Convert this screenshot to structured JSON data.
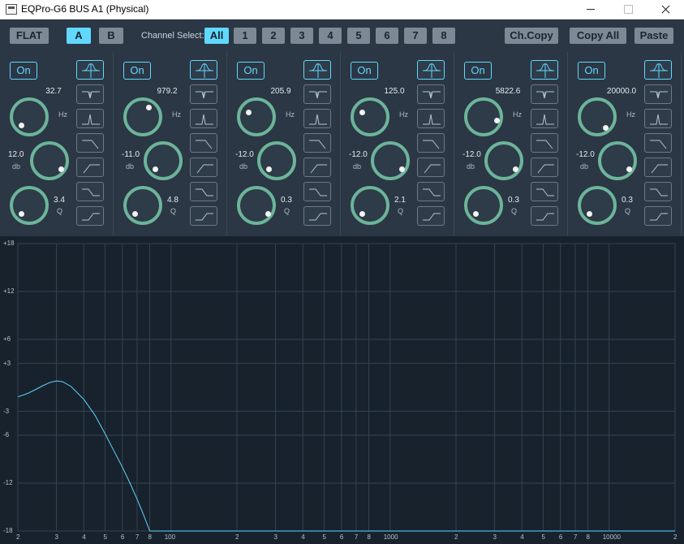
{
  "window": {
    "title": "EQPro-G6 BUS A1 (Physical)"
  },
  "toolbar": {
    "flat_label": "FLAT",
    "a_label": "A",
    "b_label": "B",
    "channel_select_label": "Channel Select:",
    "channels": [
      "All",
      "1",
      "2",
      "3",
      "4",
      "5",
      "6",
      "7",
      "8"
    ],
    "selected_channel": "All",
    "selected_bank": "A",
    "copy_label": "Ch.Copy",
    "copy_all_label": "Copy All",
    "paste_label": "Paste"
  },
  "bands": [
    {
      "on_label": "On",
      "freq": "32.7",
      "freq_unit": "Hz",
      "gain": "12.0",
      "gain_unit": "db",
      "q": "3.4",
      "q_unit": "Q",
      "active_shape": "bell"
    },
    {
      "on_label": "On",
      "freq": "979.2",
      "freq_unit": "Hz",
      "gain": "-11.0",
      "gain_unit": "db",
      "q": "4.8",
      "q_unit": "Q",
      "active_shape": "bell"
    },
    {
      "on_label": "On",
      "freq": "205.9",
      "freq_unit": "Hz",
      "gain": "-12.0",
      "gain_unit": "db",
      "q": "0.3",
      "q_unit": "Q",
      "active_shape": "bell"
    },
    {
      "on_label": "On",
      "freq": "125.0",
      "freq_unit": "Hz",
      "gain": "-12.0",
      "gain_unit": "db",
      "q": "2.1",
      "q_unit": "Q",
      "active_shape": "bell"
    },
    {
      "on_label": "On",
      "freq": "5822.6",
      "freq_unit": "Hz",
      "gain": "-12.0",
      "gain_unit": "db",
      "q": "0.3",
      "q_unit": "Q",
      "active_shape": "bell"
    },
    {
      "on_label": "On",
      "freq": "20000.0",
      "freq_unit": "Hz",
      "gain": "-12.0",
      "gain_unit": "db",
      "q": "0.3",
      "q_unit": "Q",
      "active_shape": "bell"
    }
  ],
  "filter_shapes": [
    "bell",
    "notch",
    "bandpass",
    "lowpass",
    "highpass",
    "lowshelf",
    "highshelf"
  ],
  "graph": {
    "y_labels": [
      "+18",
      "+12",
      "+6",
      "+3",
      "-3",
      "-6",
      "-12",
      "-18"
    ],
    "y_values": [
      18,
      12,
      6,
      3,
      -3,
      -6,
      -12,
      -18
    ],
    "x_labels": [
      {
        "t": "2",
        "f": 20
      },
      {
        "t": "3",
        "f": 30
      },
      {
        "t": "4",
        "f": 40
      },
      {
        "t": "5",
        "f": 50
      },
      {
        "t": "6",
        "f": 60
      },
      {
        "t": "7",
        "f": 70
      },
      {
        "t": "8",
        "f": 80
      },
      {
        "t": "100",
        "f": 100
      },
      {
        "t": "2",
        "f": 200
      },
      {
        "t": "3",
        "f": 300
      },
      {
        "t": "4",
        "f": 400
      },
      {
        "t": "5",
        "f": 500
      },
      {
        "t": "6",
        "f": 600
      },
      {
        "t": "7",
        "f": 700
      },
      {
        "t": "8",
        "f": 800
      },
      {
        "t": "1000",
        "f": 1000
      },
      {
        "t": "2",
        "f": 2000
      },
      {
        "t": "3",
        "f": 3000
      },
      {
        "t": "4",
        "f": 4000
      },
      {
        "t": "5",
        "f": 5000
      },
      {
        "t": "6",
        "f": 6000
      },
      {
        "t": "7",
        "f": 7000
      },
      {
        "t": "8",
        "f": 8000
      },
      {
        "t": "10000",
        "f": 10000
      },
      {
        "t": "2",
        "f": 20000
      }
    ],
    "curve": [
      [
        20,
        -1.2
      ],
      [
        22,
        -0.8
      ],
      [
        24,
        -0.3
      ],
      [
        26,
        0.2
      ],
      [
        28,
        0.6
      ],
      [
        30,
        0.8
      ],
      [
        32,
        0.7
      ],
      [
        35,
        0.1
      ],
      [
        40,
        -1.5
      ],
      [
        45,
        -3.5
      ],
      [
        50,
        -5.8
      ],
      [
        55,
        -8.0
      ],
      [
        60,
        -10.0
      ],
      [
        65,
        -12.0
      ],
      [
        70,
        -14.0
      ],
      [
        75,
        -16.0
      ],
      [
        80,
        -18.0
      ],
      [
        20000,
        -18.0
      ]
    ],
    "colors": {
      "curve": "#5fd6ff",
      "grid": "#34434f",
      "background": "#17222d"
    }
  }
}
